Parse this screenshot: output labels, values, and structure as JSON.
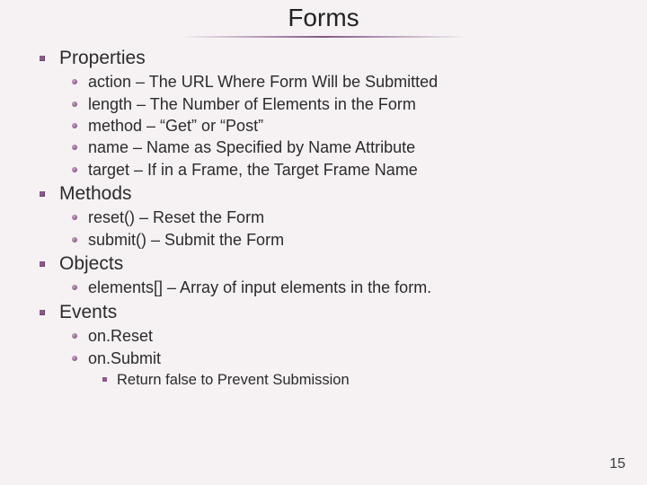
{
  "title": "Forms",
  "sections": [
    {
      "heading": "Properties",
      "items": [
        "action – The URL Where Form Will be Submitted",
        "length – The Number of Elements in the Form",
        "method – “Get” or “Post”",
        "name – Name as Specified by Name Attribute",
        "target – If in a Frame, the Target Frame Name"
      ]
    },
    {
      "heading": "Methods",
      "items": [
        "reset() – Reset the Form",
        "submit() – Submit the Form"
      ]
    },
    {
      "heading": "Objects",
      "items": [
        "elements[] – Array of input elements in the form."
      ]
    },
    {
      "heading": "Events",
      "items": [
        "on.Reset",
        "on.Submit"
      ],
      "subnote": "Return false to Prevent Submission"
    }
  ],
  "page_number": "15"
}
